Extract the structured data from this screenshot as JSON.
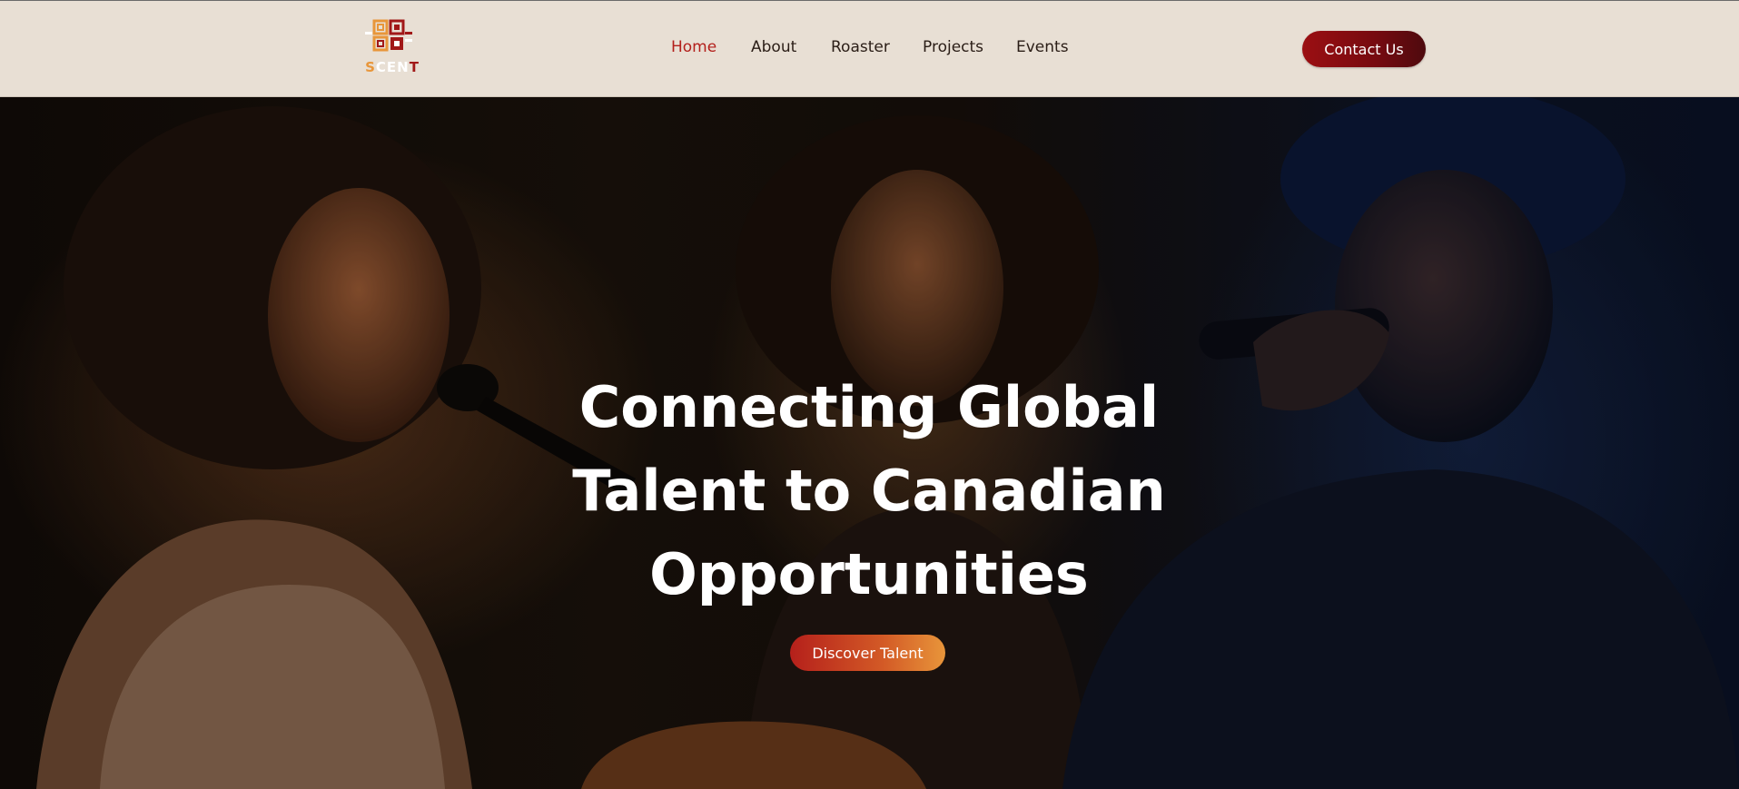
{
  "logo": {
    "letters": [
      "S",
      "C",
      "E",
      "N",
      "T"
    ],
    "alt": "ScenT logo"
  },
  "nav": {
    "items": [
      {
        "label": "Home",
        "active": true
      },
      {
        "label": "About",
        "active": false
      },
      {
        "label": "Roaster",
        "active": false
      },
      {
        "label": "Projects",
        "active": false
      },
      {
        "label": "Events",
        "active": false
      }
    ],
    "active_color": "#b31f1b"
  },
  "header": {
    "contact_label": "Contact Us",
    "background": "#e8dfd4"
  },
  "hero": {
    "title_line1": "Connecting Global",
    "title_line2": "Talent to Canadian",
    "title_line3": "Opportunities",
    "cta_label": "Discover Talent"
  },
  "colors": {
    "brand_dark_red": "#760a10",
    "brand_orange": "#e8953a"
  }
}
